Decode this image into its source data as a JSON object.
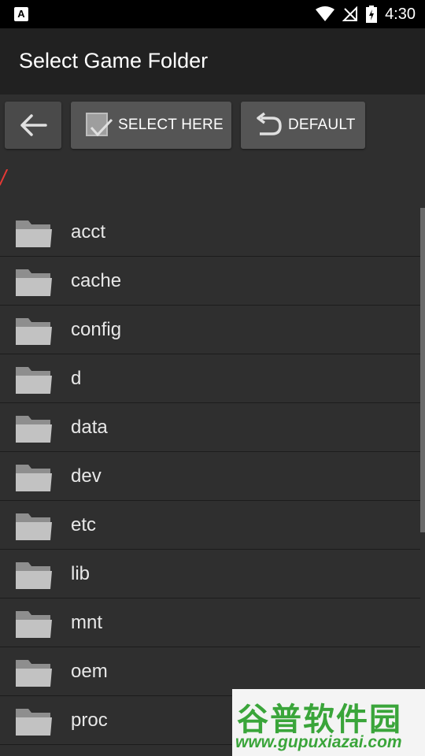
{
  "status_bar": {
    "time": "4:30",
    "notification_icon_letter": "A",
    "icons": [
      "wifi-icon",
      "signal-off-icon",
      "battery-charging-icon"
    ]
  },
  "header": {
    "title": "Select Game Folder"
  },
  "toolbar": {
    "back_icon": "arrow-left-icon",
    "select_label": "SELECT HERE",
    "default_label": "DEFAULT"
  },
  "current_path": "/",
  "folders": [
    "acct",
    "cache",
    "config",
    "d",
    "data",
    "dev",
    "etc",
    "lib",
    "mnt",
    "oem",
    "proc"
  ],
  "watermark": {
    "text": "谷普软件园",
    "url": "www.gupuxiazai.com"
  },
  "colors": {
    "background": "#2f2f2f",
    "titlebar": "#212121",
    "button": "#555555",
    "path": "#e53935",
    "folder_icon": "#bdbdbd"
  }
}
